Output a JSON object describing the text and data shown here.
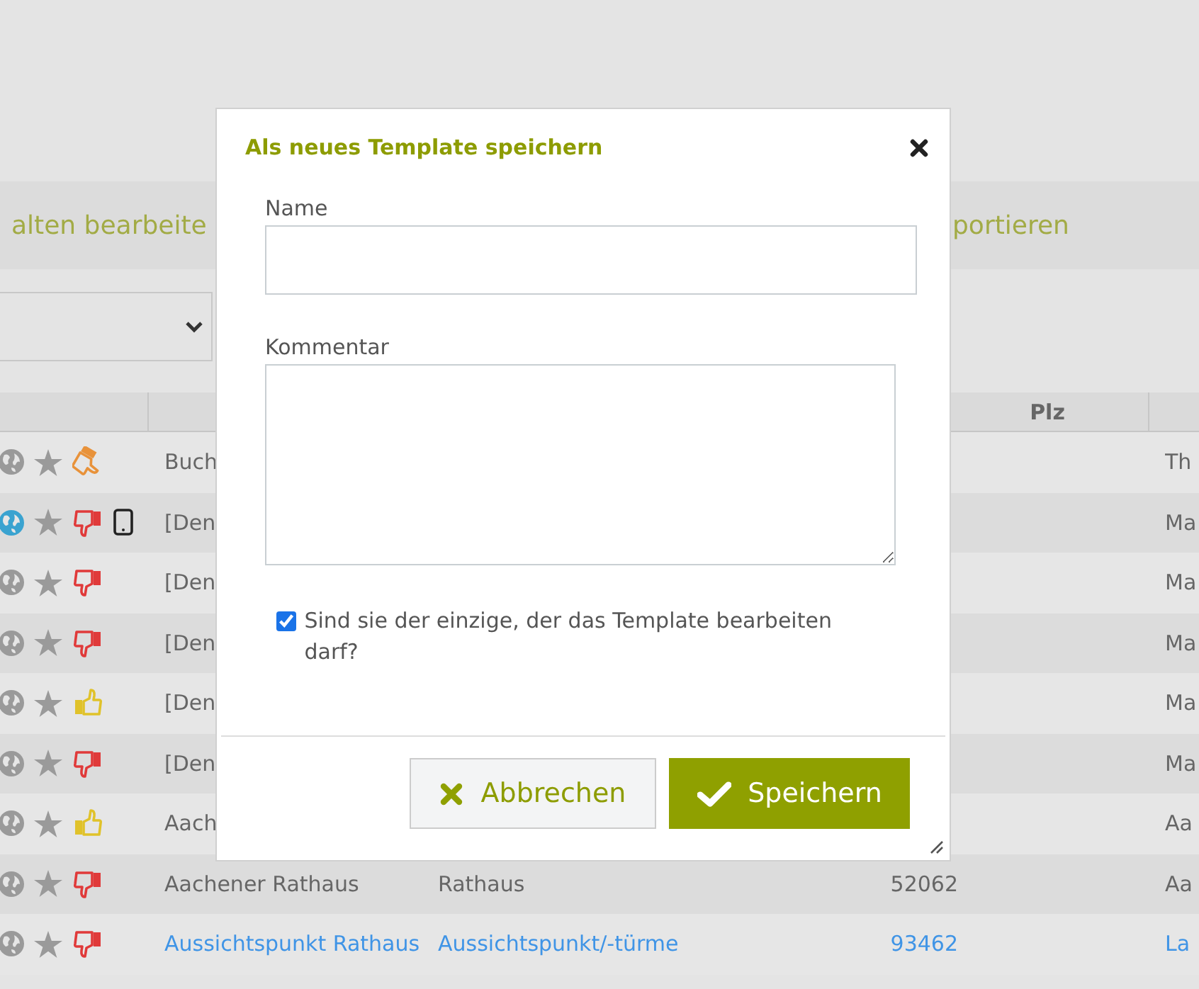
{
  "toolbar": {
    "left_action": "alten bearbeite",
    "right_action": "portieren"
  },
  "table": {
    "plz_header": "Plz",
    "rows": [
      {
        "globe_active": false,
        "thumb": {
          "kind": "side",
          "color": "#e8923a"
        },
        "mobile": false,
        "link": false,
        "name": "Buch",
        "city": "Th"
      },
      {
        "globe_active": true,
        "thumb": {
          "kind": "down",
          "color": "#e03a3a"
        },
        "mobile": true,
        "link": false,
        "name": "[Den",
        "city": "Ma"
      },
      {
        "globe_active": false,
        "thumb": {
          "kind": "down",
          "color": "#e03a3a"
        },
        "mobile": false,
        "link": false,
        "name": "[Den",
        "city": "Ma"
      },
      {
        "globe_active": false,
        "thumb": {
          "kind": "down",
          "color": "#e03a3a"
        },
        "mobile": false,
        "link": false,
        "name": "[Den",
        "city": "Ma"
      },
      {
        "globe_active": false,
        "thumb": {
          "kind": "up",
          "color": "#e0c22a"
        },
        "mobile": false,
        "link": false,
        "name": "[Den",
        "city": "Ma"
      },
      {
        "globe_active": false,
        "thumb": {
          "kind": "down",
          "color": "#e03a3a"
        },
        "mobile": false,
        "link": false,
        "name": "[Den",
        "city": "Ma"
      },
      {
        "globe_active": false,
        "thumb": {
          "kind": "up",
          "color": "#e0c22a"
        },
        "mobile": false,
        "link": false,
        "name": "Aach",
        "city": "Aa"
      },
      {
        "globe_active": false,
        "thumb": {
          "kind": "down",
          "color": "#e03a3a"
        },
        "mobile": false,
        "link": false,
        "name": "Aachener Rathaus",
        "category": "Rathaus",
        "plz": "52062",
        "city": "Aa"
      },
      {
        "globe_active": false,
        "thumb": {
          "kind": "down",
          "color": "#e03a3a"
        },
        "mobile": false,
        "link": true,
        "name": "Aussichtspunkt Rathaus",
        "category": "Aussichtspunkt/-türme",
        "plz": "93462",
        "city": "La"
      }
    ]
  },
  "dialog": {
    "title": "Als neues Template speichern",
    "name_label": "Name",
    "comment_label": "Kommentar",
    "private": {
      "label": "Sind sie der einzige, der das Template bearbeiten darf?",
      "checked": true
    },
    "buttons": [
      {
        "kind": "cancel",
        "label": "Abbrechen"
      },
      {
        "kind": "primary",
        "label": "Speichern"
      }
    ]
  }
}
